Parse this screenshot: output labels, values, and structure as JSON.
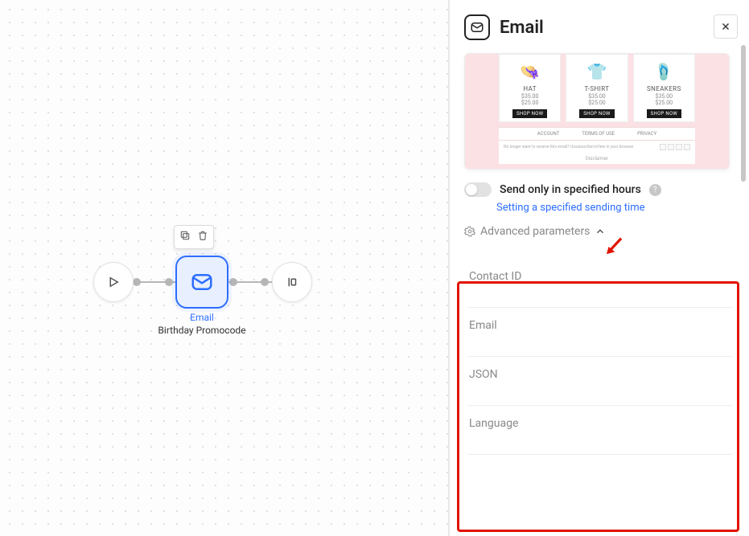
{
  "panel": {
    "title": "Email",
    "toggle_label": "Send only in specified hours",
    "link_text": "Setting a specified sending time",
    "advanced_label": "Advanced parameters",
    "fields": {
      "contact_id": "Contact ID",
      "email": "Email",
      "json": "JSON",
      "language": "Language"
    }
  },
  "preview": {
    "products": [
      {
        "name": "HAT",
        "price1": "$35.00",
        "price2": "$25.00",
        "btn": "SHOP NOW",
        "emoji": "👒"
      },
      {
        "name": "T-SHIRT",
        "price1": "$35.00",
        "price2": "$25.00",
        "btn": "SHOP NOW",
        "emoji": "👕"
      },
      {
        "name": "SNEAKERS",
        "price1": "$35.00",
        "price2": "$25.00",
        "btn": "SHOP NOW",
        "emoji": "🩴"
      }
    ],
    "footer_links": [
      "ACCOUNT",
      "TERMS OF USE",
      "PRIVACY"
    ],
    "fineprint": "No longer want to receive this email? Unsubscribe\\nView in your browser",
    "bottom": "Disclaimer"
  },
  "workflow": {
    "center_label": "Email",
    "center_caption": "Birthday Promocode"
  }
}
